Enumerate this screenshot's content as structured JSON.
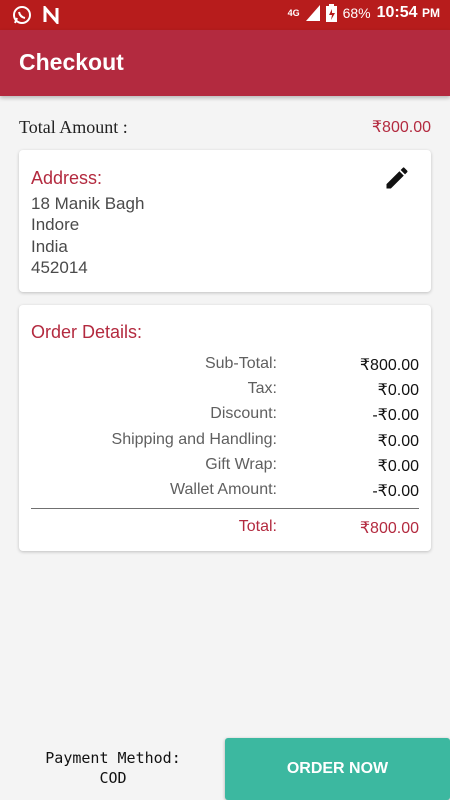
{
  "status_bar": {
    "network": "4G",
    "battery": "68%",
    "time": "10:54",
    "ampm": "PM",
    "icons": [
      "whatsapp-icon",
      "n-app-icon",
      "signal-icon",
      "battery-icon"
    ]
  },
  "header": {
    "title": "Checkout"
  },
  "summary": {
    "total_label": "Total Amount :",
    "total_value": "₹800.00"
  },
  "address": {
    "title": "Address:",
    "lines": [
      "18 Manik Bagh",
      "Indore",
      "India",
      "452014"
    ],
    "edit_icon": "pencil-icon"
  },
  "order": {
    "title": "Order Details:",
    "rows": [
      {
        "label": "Sub-Total:",
        "value": "₹800.00"
      },
      {
        "label": "Tax:",
        "value": "₹0.00"
      },
      {
        "label": "Discount:",
        "value": "-₹0.00"
      },
      {
        "label": "Shipping and Handling:",
        "value": "₹0.00"
      },
      {
        "label": "Gift Wrap:",
        "value": "₹0.00"
      },
      {
        "label": "Wallet Amount:",
        "value": "-₹0.00"
      }
    ],
    "total": {
      "label": "Total:",
      "value": "₹800.00"
    }
  },
  "footer": {
    "payment_label": "Payment Method:",
    "payment_value": "COD",
    "order_button": "ORDER NOW"
  },
  "colors": {
    "status_bar": "#b71c1c",
    "app_bar": "#b32a3f",
    "accent": "#b32a3f",
    "button": "#3cb8a0"
  }
}
